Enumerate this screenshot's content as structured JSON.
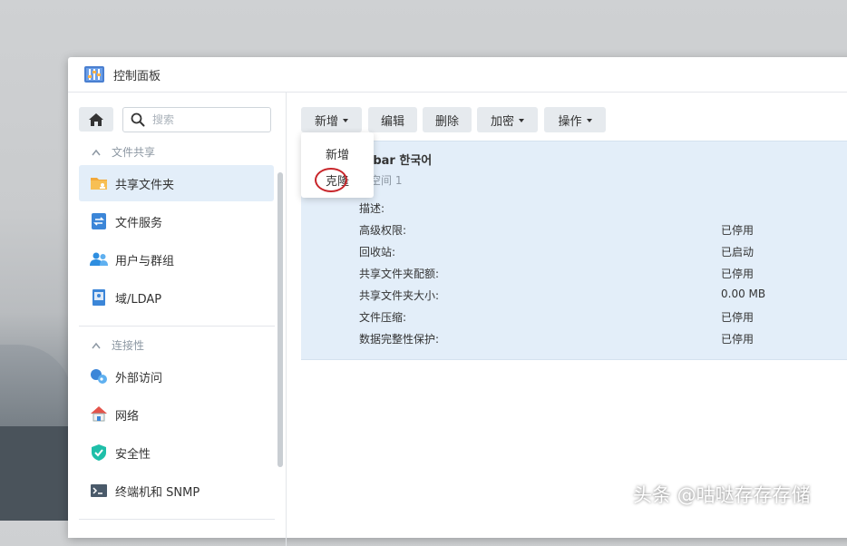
{
  "window": {
    "title": "控制面板"
  },
  "sidebar": {
    "search_placeholder": "搜索",
    "sections": [
      {
        "header": "文件共享",
        "items": [
          {
            "label": "共享文件夹",
            "icon": "folder-share-icon",
            "active": true
          },
          {
            "label": "文件服务",
            "icon": "file-services-icon"
          },
          {
            "label": "用户与群组",
            "icon": "users-icon"
          },
          {
            "label": "域/LDAP",
            "icon": "domain-icon"
          }
        ]
      },
      {
        "header": "连接性",
        "items": [
          {
            "label": "外部访问",
            "icon": "external-access-icon"
          },
          {
            "label": "网络",
            "icon": "network-icon"
          },
          {
            "label": "安全性",
            "icon": "security-shield-icon"
          },
          {
            "label": "终端机和 SNMP",
            "icon": "terminal-icon"
          }
        ]
      }
    ]
  },
  "toolbar": {
    "create": "新增",
    "edit": "编辑",
    "delete": "删除",
    "encrypt": "加密",
    "action": "操作"
  },
  "dropdown": {
    "items": [
      "新增",
      "克隆"
    ]
  },
  "share": {
    "name": "orbar 한국어",
    "volume": "储空间 1",
    "properties": [
      {
        "label": "描述:",
        "value": ""
      },
      {
        "label": "高级权限:",
        "value": "已停用"
      },
      {
        "label": "回收站:",
        "value": "已启动"
      },
      {
        "label": "共享文件夹配额:",
        "value": "已停用"
      },
      {
        "label": "共享文件夹大小:",
        "value": "0.00 MB"
      },
      {
        "label": "文件压缩:",
        "value": "已停用"
      },
      {
        "label": "数据完整性保护:",
        "value": "已停用"
      }
    ]
  },
  "watermark": "头条 @咕哒存存存储",
  "colors": {
    "accent": "#1d7cd8",
    "selection": "#e3eef9",
    "annotation": "#c8262b"
  }
}
